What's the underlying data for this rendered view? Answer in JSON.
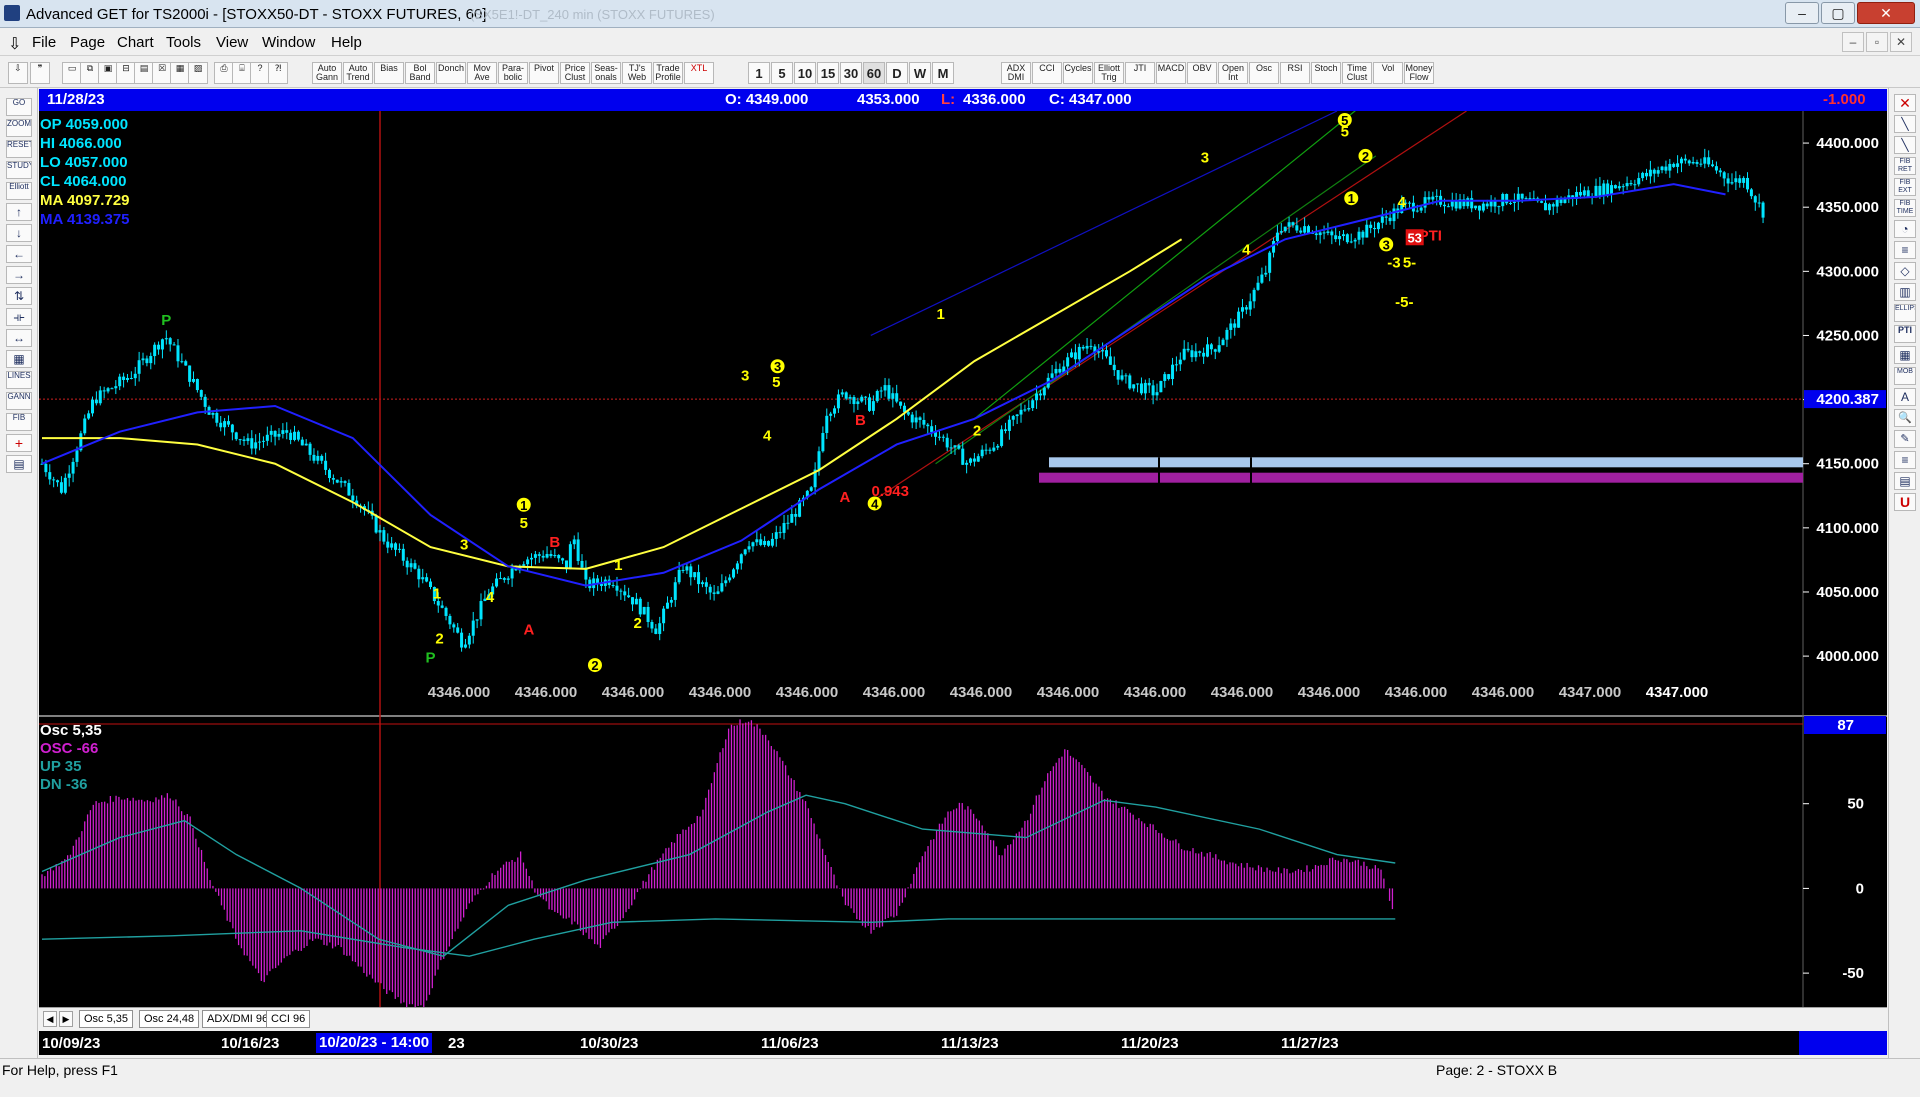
{
  "window": {
    "title": "Advanced GET for TS2000i - [STOXX50-DT - STOXX FUTURES, 60]",
    "watermark": "(SX5E1!-DT_240 min (STOXX FUTURES)",
    "minimize": "–",
    "maximize": "▢",
    "close": "✕"
  },
  "menu": {
    "items": [
      "File",
      "Page",
      "Chart",
      "Tools",
      "View",
      "Window",
      "Help"
    ]
  },
  "toolbar": {
    "study_buttons": [
      "Auto Gann",
      "Auto Trend",
      "Bias",
      "Bol Band",
      "Donch",
      "Mov Ave",
      "Para- bolic",
      "Pivot",
      "Price Clust",
      "Seas- onals",
      "TJ's Web",
      "Trade Profile",
      "XTL"
    ],
    "timeframes": [
      "1",
      "5",
      "10",
      "15",
      "30",
      "60",
      "D",
      "W",
      "M"
    ],
    "indicator_buttons": [
      "ADX DMI",
      "CCI",
      "Cycles",
      "Elliott Trig",
      "JTI",
      "MACD",
      "OBV",
      "Open Int",
      "Osc",
      "RSI",
      "Stoch",
      "Time Clust",
      "Vol",
      "Money Flow"
    ]
  },
  "left_tools": [
    "GO",
    "ZOOM",
    "RESET",
    "STUDY",
    "Elliott",
    "↑",
    "↓",
    "←",
    "→",
    "⇅",
    "⟛",
    "↔",
    "▦",
    "LINES",
    "GANN",
    "FIB",
    "+",
    "▤"
  ],
  "right_tools": [
    "✕",
    "╲",
    "╲",
    "FIB RET",
    "FIB EXT",
    "FIB TIME",
    "◔",
    "≡",
    "◇",
    "▥",
    "ELLIPSE",
    "PTI",
    "▦",
    "MOB",
    "A",
    "🔍",
    "✎",
    "≡",
    "▤",
    "U"
  ],
  "info_bar": {
    "date": "11/28/23",
    "open": "O: 4349.000",
    "high": "4353.000",
    "low_prefix": "L:",
    "low": "4336.000",
    "close": "C: 4347.000",
    "change": "-1.000"
  },
  "legend": {
    "op": "OP  4059.000",
    "hi": "HI  4066.000",
    "lo": "LO  4057.000",
    "cl": "CL  4064.000",
    "ma1": "MA  4097.729",
    "ma2": "MA  4139.375"
  },
  "osc_legend": {
    "name": "Osc 5,35",
    "osc": "OSC -66",
    "up": "UP  35",
    "dn": "DN  -36"
  },
  "colors": {
    "background": "#000000",
    "candle": "#00e5ff",
    "ma_fast": "#ffff40",
    "ma_slow": "#2020ff",
    "osc": "#d020d0",
    "osc_band": "#20a0a0",
    "label_yellow": "#ffff00",
    "label_red": "#ff2020",
    "label_green": "#20c020"
  },
  "tabs": [
    "Osc 5,35",
    "Osc 24,48",
    "ADX/DMI 96",
    "CCI 96"
  ],
  "status": {
    "help": "For Help, press F1",
    "page": "Page: 2 - STOXX B"
  },
  "chart_data": {
    "type": "candlestick",
    "price_axis": {
      "ticks": [
        "4400.000",
        "4350.000",
        "4300.000",
        "4250.000",
        "4200.000",
        "4150.000",
        "4100.000",
        "4050.000",
        "4000.000"
      ],
      "ylim": [
        3965,
        4425
      ],
      "current_marker": "4200.387"
    },
    "date_labels": [
      "10/09/23",
      "10/16/23",
      "10/20/23 - 14:00",
      "23",
      "10/30/23",
      "11/06/23",
      "11/13/23",
      "11/20/23",
      "11/27/23"
    ],
    "bottom_values": [
      "4346.000",
      "4346.000",
      "4346.000",
      "4346.000",
      "4346.000",
      "4346.000",
      "4346.000",
      "4346.000",
      "4346.000",
      "4346.000",
      "4346.000",
      "4346.000",
      "4346.000",
      "4347.000",
      "4347.000"
    ],
    "price_path": [
      [
        0,
        4150
      ],
      [
        15,
        4130
      ],
      [
        40,
        4200
      ],
      [
        70,
        4220
      ],
      [
        95,
        4250
      ],
      [
        110,
        4225
      ],
      [
        130,
        4190
      ],
      [
        160,
        4165
      ],
      [
        190,
        4175
      ],
      [
        215,
        4150
      ],
      [
        245,
        4120
      ],
      [
        265,
        4090
      ],
      [
        290,
        4065
      ],
      [
        310,
        4035
      ],
      [
        325,
        4010
      ],
      [
        345,
        4050
      ],
      [
        370,
        4075
      ],
      [
        390,
        4080
      ],
      [
        405,
        4070
      ],
      [
        410,
        4095
      ],
      [
        420,
        4055
      ],
      [
        440,
        4060
      ],
      [
        460,
        4040
      ],
      [
        475,
        4020
      ],
      [
        495,
        4070
      ],
      [
        520,
        4045
      ],
      [
        545,
        4090
      ],
      [
        560,
        4085
      ],
      [
        580,
        4110
      ],
      [
        595,
        4130
      ],
      [
        605,
        4190
      ],
      [
        620,
        4205
      ],
      [
        640,
        4195
      ],
      [
        650,
        4210
      ],
      [
        665,
        4190
      ],
      [
        690,
        4175
      ],
      [
        715,
        4150
      ],
      [
        735,
        4165
      ],
      [
        760,
        4195
      ],
      [
        785,
        4225
      ],
      [
        810,
        4245
      ],
      [
        835,
        4215
      ],
      [
        860,
        4205
      ],
      [
        880,
        4235
      ],
      [
        905,
        4240
      ],
      [
        925,
        4265
      ],
      [
        945,
        4300
      ],
      [
        955,
        4335
      ],
      [
        975,
        4335
      ],
      [
        1000,
        4325
      ],
      [
        1020,
        4330
      ],
      [
        1050,
        4350
      ],
      [
        1080,
        4355
      ],
      [
        1110,
        4352
      ],
      [
        1135,
        4357
      ],
      [
        1160,
        4350
      ],
      [
        1185,
        4360
      ],
      [
        1210,
        4365
      ],
      [
        1240,
        4375
      ],
      [
        1260,
        4385
      ],
      [
        1282,
        4385
      ],
      [
        1292,
        4380
      ],
      [
        1305,
        4370
      ],
      [
        1315,
        4372
      ],
      [
        1322,
        4358
      ],
      [
        1330,
        4345
      ]
    ],
    "ma_fast": [
      [
        0,
        4170
      ],
      [
        60,
        4170
      ],
      [
        120,
        4165
      ],
      [
        180,
        4150
      ],
      [
        240,
        4120
      ],
      [
        300,
        4085
      ],
      [
        360,
        4070
      ],
      [
        420,
        4068
      ],
      [
        480,
        4085
      ],
      [
        540,
        4115
      ],
      [
        600,
        4145
      ],
      [
        660,
        4185
      ],
      [
        720,
        4230
      ],
      [
        780,
        4265
      ],
      [
        840,
        4300
      ],
      [
        880,
        4325
      ]
    ],
    "ma_slow": [
      [
        0,
        4150
      ],
      [
        60,
        4175
      ],
      [
        120,
        4190
      ],
      [
        180,
        4195
      ],
      [
        240,
        4170
      ],
      [
        300,
        4110
      ],
      [
        360,
        4070
      ],
      [
        420,
        4055
      ],
      [
        480,
        4065
      ],
      [
        540,
        4090
      ],
      [
        600,
        4130
      ],
      [
        660,
        4165
      ],
      [
        720,
        4185
      ],
      [
        780,
        4215
      ],
      [
        840,
        4255
      ],
      [
        900,
        4295
      ],
      [
        960,
        4325
      ],
      [
        1020,
        4340
      ],
      [
        1080,
        4355
      ],
      [
        1140,
        4355
      ],
      [
        1200,
        4358
      ],
      [
        1260,
        4368
      ],
      [
        1300,
        4360
      ]
    ],
    "wave_labels": [
      {
        "t": "P",
        "x": 96,
        "y": 4258,
        "c": "green"
      },
      {
        "t": "P",
        "x": 300,
        "y": 3995,
        "c": "green"
      },
      {
        "t": "1",
        "x": 305,
        "y": 4045,
        "c": "yellow"
      },
      {
        "t": "2",
        "x": 307,
        "y": 4010,
        "c": "yellow"
      },
      {
        "t": "3",
        "x": 326,
        "y": 4083,
        "c": "yellow"
      },
      {
        "t": "4",
        "x": 346,
        "y": 4042,
        "c": "yellow"
      },
      {
        "t": "5",
        "x": 372,
        "y": 4100,
        "c": "yellow"
      },
      {
        "t": "A",
        "x": 376,
        "y": 4017,
        "c": "red"
      },
      {
        "t": "B",
        "x": 396,
        "y": 4085,
        "c": "red"
      },
      {
        "t": "1",
        "x": 445,
        "y": 4067,
        "c": "yellow"
      },
      {
        "t": "2",
        "x": 460,
        "y": 4022,
        "c": "yellow"
      },
      {
        "t": "3",
        "x": 543,
        "y": 4215,
        "c": "yellow"
      },
      {
        "t": "4",
        "x": 560,
        "y": 4168,
        "c": "yellow"
      },
      {
        "t": "5",
        "x": 567,
        "y": 4210,
        "c": "yellow"
      },
      {
        "t": "A",
        "x": 620,
        "y": 4120,
        "c": "red"
      },
      {
        "t": "B",
        "x": 632,
        "y": 4180,
        "c": "red"
      },
      {
        "t": "0.943",
        "x": 655,
        "y": 4125,
        "c": "red"
      },
      {
        "t": "1",
        "x": 694,
        "y": 4263,
        "c": "yellow"
      },
      {
        "t": "2",
        "x": 722,
        "y": 4172,
        "c": "yellow"
      },
      {
        "t": "3",
        "x": 898,
        "y": 4385,
        "c": "yellow"
      },
      {
        "t": "4",
        "x": 930,
        "y": 4313,
        "c": "yellow"
      },
      {
        "t": "5",
        "x": 1006,
        "y": 4405,
        "c": "yellow"
      },
      {
        "t": "4",
        "x": 1050,
        "y": 4350,
        "c": "yellow"
      },
      {
        "t": "-3",
        "x": 1044,
        "y": 4303,
        "c": "yellow"
      },
      {
        "t": "5-",
        "x": 1056,
        "y": 4303,
        "c": "yellow"
      },
      {
        "t": "-5-",
        "x": 1052,
        "y": 4272,
        "c": "yellow"
      },
      {
        "t": "PTI",
        "x": 1072,
        "y": 4324,
        "c": "red"
      }
    ],
    "circle_labels": [
      {
        "t": "1",
        "x": 372,
        "y": 4118
      },
      {
        "t": "2",
        "x": 427,
        "y": 3993
      },
      {
        "t": "3",
        "x": 568,
        "y": 4226
      },
      {
        "t": "4",
        "x": 643,
        "y": 4119
      },
      {
        "t": "5",
        "x": 1006,
        "y": 4418
      },
      {
        "t": "2",
        "x": 1022,
        "y": 4390
      },
      {
        "t": "1",
        "x": 1011,
        "y": 4357
      },
      {
        "t": "3",
        "x": 1038,
        "y": 4321
      }
    ],
    "pti_value": "53",
    "osc_axis": {
      "ticks": [
        "50",
        "0",
        "-50"
      ],
      "ylim": [
        -70,
        100
      ],
      "top_marker": "87"
    },
    "osc_path": [
      [
        0,
        8
      ],
      [
        20,
        18
      ],
      [
        40,
        50
      ],
      [
        60,
        54
      ],
      [
        80,
        52
      ],
      [
        100,
        55
      ],
      [
        115,
        40
      ],
      [
        130,
        5
      ],
      [
        150,
        -30
      ],
      [
        170,
        -55
      ],
      [
        190,
        -40
      ],
      [
        210,
        -30
      ],
      [
        230,
        -35
      ],
      [
        250,
        -50
      ],
      [
        265,
        -60
      ],
      [
        280,
        -68
      ],
      [
        295,
        -70
      ],
      [
        310,
        -40
      ],
      [
        330,
        -10
      ],
      [
        350,
        10
      ],
      [
        370,
        20
      ],
      [
        380,
        0
      ],
      [
        395,
        -15
      ],
      [
        410,
        -20
      ],
      [
        430,
        -35
      ],
      [
        450,
        -15
      ],
      [
        470,
        10
      ],
      [
        490,
        30
      ],
      [
        510,
        45
      ],
      [
        530,
        95
      ],
      [
        545,
        100
      ],
      [
        560,
        90
      ],
      [
        575,
        70
      ],
      [
        590,
        50
      ],
      [
        605,
        20
      ],
      [
        620,
        -10
      ],
      [
        640,
        -25
      ],
      [
        660,
        -15
      ],
      [
        680,
        20
      ],
      [
        700,
        45
      ],
      [
        710,
        50
      ],
      [
        725,
        40
      ],
      [
        740,
        20
      ],
      [
        760,
        40
      ],
      [
        775,
        65
      ],
      [
        790,
        82
      ],
      [
        805,
        70
      ],
      [
        820,
        55
      ],
      [
        840,
        45
      ],
      [
        860,
        35
      ],
      [
        880,
        25
      ],
      [
        900,
        20
      ],
      [
        920,
        15
      ],
      [
        940,
        12
      ],
      [
        960,
        10
      ],
      [
        980,
        12
      ],
      [
        1000,
        18
      ],
      [
        1020,
        15
      ],
      [
        1035,
        10
      ],
      [
        1045,
        -20
      ]
    ],
    "osc_up_path": [
      [
        0,
        10
      ],
      [
        60,
        30
      ],
      [
        110,
        40
      ],
      [
        150,
        20
      ],
      [
        200,
        0
      ],
      [
        260,
        -30
      ],
      [
        310,
        -40
      ],
      [
        360,
        -10
      ],
      [
        420,
        5
      ],
      [
        500,
        20
      ],
      [
        560,
        45
      ],
      [
        590,
        55
      ],
      [
        620,
        50
      ],
      [
        680,
        35
      ],
      [
        760,
        30
      ],
      [
        820,
        52
      ],
      [
        860,
        48
      ],
      [
        940,
        35
      ],
      [
        1000,
        20
      ],
      [
        1045,
        15
      ]
    ],
    "osc_dn_path": [
      [
        0,
        -30
      ],
      [
        100,
        -28
      ],
      [
        200,
        -25
      ],
      [
        280,
        -35
      ],
      [
        330,
        -40
      ],
      [
        380,
        -30
      ],
      [
        440,
        -20
      ],
      [
        520,
        -18
      ],
      [
        640,
        -20
      ],
      [
        700,
        -18
      ],
      [
        800,
        -18
      ],
      [
        900,
        -18
      ],
      [
        1000,
        -18
      ],
      [
        1045,
        -18
      ]
    ]
  }
}
